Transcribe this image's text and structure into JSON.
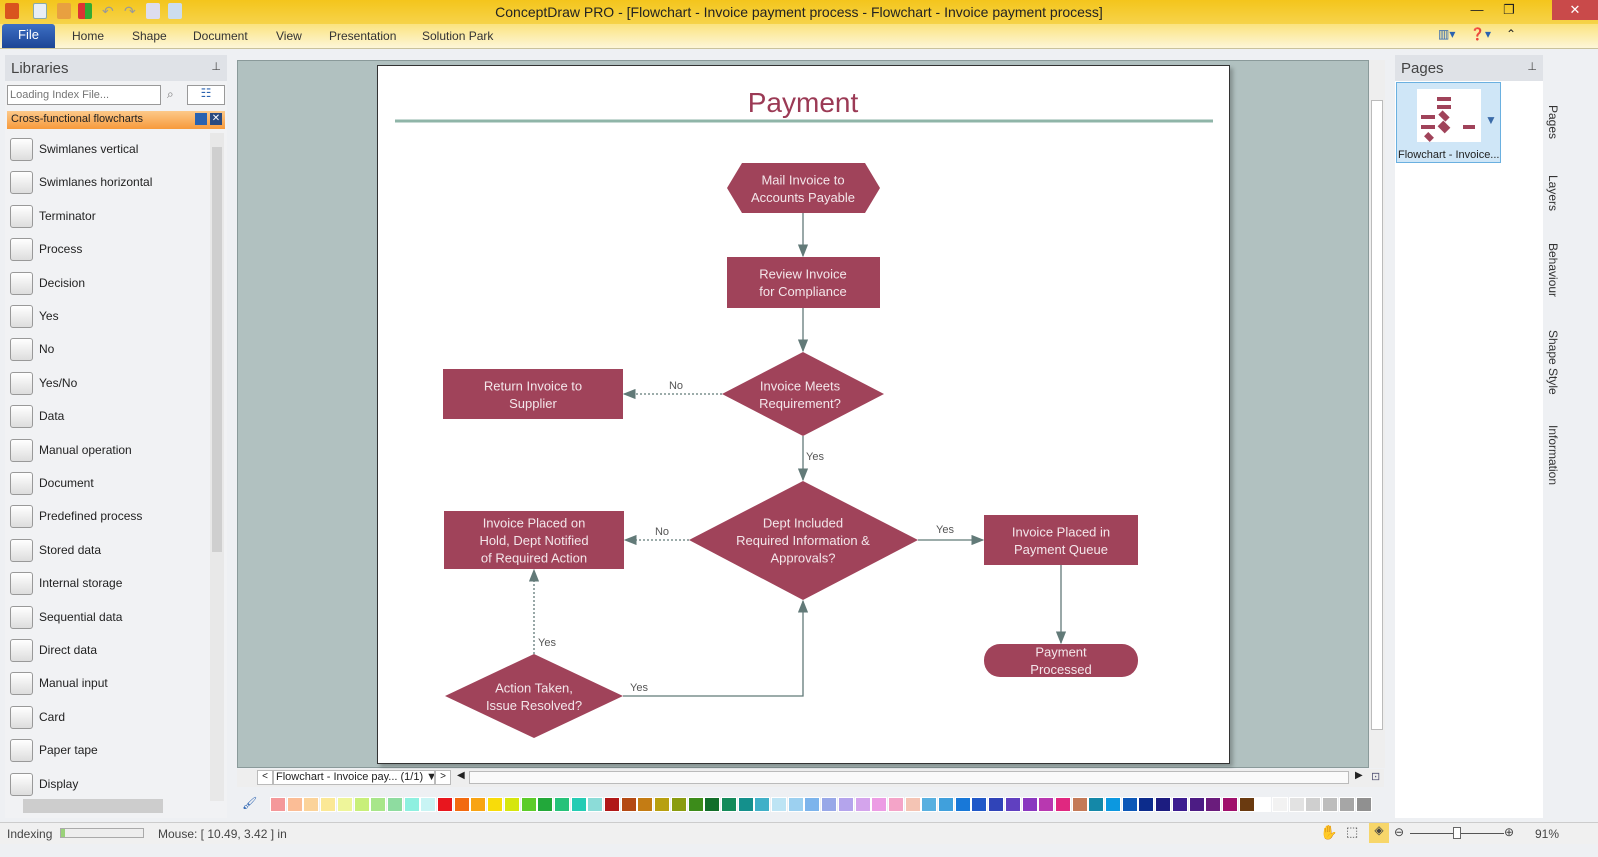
{
  "window": {
    "title": "ConceptDraw PRO - [Flowchart - Invoice payment process - Flowchart - Invoice payment process]"
  },
  "ribbon": {
    "file": "File",
    "tabs": [
      "Home",
      "Shape",
      "Document",
      "View",
      "Presentation",
      "Solution Park"
    ]
  },
  "libraries": {
    "title": "Libraries",
    "search_placeholder": "Loading Index File...",
    "active_library": "Cross-functional flowcharts",
    "items": [
      "Swimlanes vertical",
      "Swimlanes horizontal",
      "Terminator",
      "Process",
      "Decision",
      "Yes",
      "No",
      "Yes/No",
      "Data",
      "Manual operation",
      "Document",
      "Predefined process",
      "Stored data",
      "Internal storage",
      "Sequential data",
      "Direct data",
      "Manual input",
      "Card",
      "Paper tape",
      "Display"
    ]
  },
  "diagram": {
    "title": "Payment",
    "shape_color": "#a0435a",
    "title_color": "#9b3a55",
    "shapes": {
      "mail": [
        "Mail Invoice to",
        "Accounts Payable"
      ],
      "review": [
        "Review Invoice",
        "for Compliance"
      ],
      "meets": [
        "Invoice Meets",
        "Requirement?"
      ],
      "return": [
        "Return Invoice to",
        "Supplier"
      ],
      "dept": [
        "Dept Included",
        "Required Information &",
        "Approvals?"
      ],
      "hold": [
        "Invoice Placed on",
        "Hold, Dept Notified",
        "of Required Action"
      ],
      "queue": [
        "Invoice Placed in",
        "Payment Queue"
      ],
      "processed": [
        "Payment",
        "Processed"
      ],
      "action": [
        "Action Taken,",
        "Issue Resolved?"
      ]
    },
    "labels": {
      "no1": "No",
      "yes1": "Yes",
      "no2": "No",
      "yes2": "Yes",
      "yes3": "Yes",
      "yes4": "Yes"
    }
  },
  "page_nav": {
    "current": "Flowchart - Invoice pay... (1/1)"
  },
  "pages": {
    "title": "Pages",
    "thumbnail_label": "Flowchart - Invoice..."
  },
  "side_tabs": [
    "Pages",
    "Layers",
    "Behaviour",
    "Shape Style",
    "Information"
  ],
  "palette": [
    "#f4989a",
    "#fbbd96",
    "#fbd39a",
    "#fbe896",
    "#eef59a",
    "#c8ef7a",
    "#a8e68a",
    "#8edca0",
    "#8ef0e0",
    "#c8f4f4",
    "#e8161e",
    "#f26a10",
    "#f8a414",
    "#f8dc0a",
    "#d6e60e",
    "#5ccc2a",
    "#22a83a",
    "#26c27a",
    "#24ccb4",
    "#8cdcd8",
    "#b01818",
    "#b44a14",
    "#c47c14",
    "#b8a010",
    "#8a9c10",
    "#3c8c1a",
    "#126e2a",
    "#148a5a",
    "#14908c",
    "#40b0c8",
    "#bde4f4",
    "#9cd0f0",
    "#7cb4ec",
    "#98a8e8",
    "#b4a4ec",
    "#d4a4ec",
    "#ec9ce4",
    "#f4a4c8",
    "#f4c4b4",
    "#58b0e0",
    "#40a0dc",
    "#1878d8",
    "#2058c8",
    "#3044b8",
    "#6040c0",
    "#8a38c0",
    "#b838b0",
    "#e02880",
    "#c47a58",
    "#1488a8",
    "#0c98e0",
    "#0c58b8",
    "#0c2c8c",
    "#1c1c80",
    "#3c1c90",
    "#4c1c84",
    "#6a1c7c",
    "#a0106c",
    "#6a3a10",
    "#ffffff",
    "#f2f2f2",
    "#e2e2e2",
    "#cfcfcf",
    "#bdbdbd",
    "#a6a6a6",
    "#909090"
  ],
  "status": {
    "indexing": "Indexing",
    "mouse": "Mouse: [ 10.49, 3.42 ] in",
    "zoom": "91%",
    "zoom_level": 0.5,
    "indexing_progress": 0.05
  }
}
